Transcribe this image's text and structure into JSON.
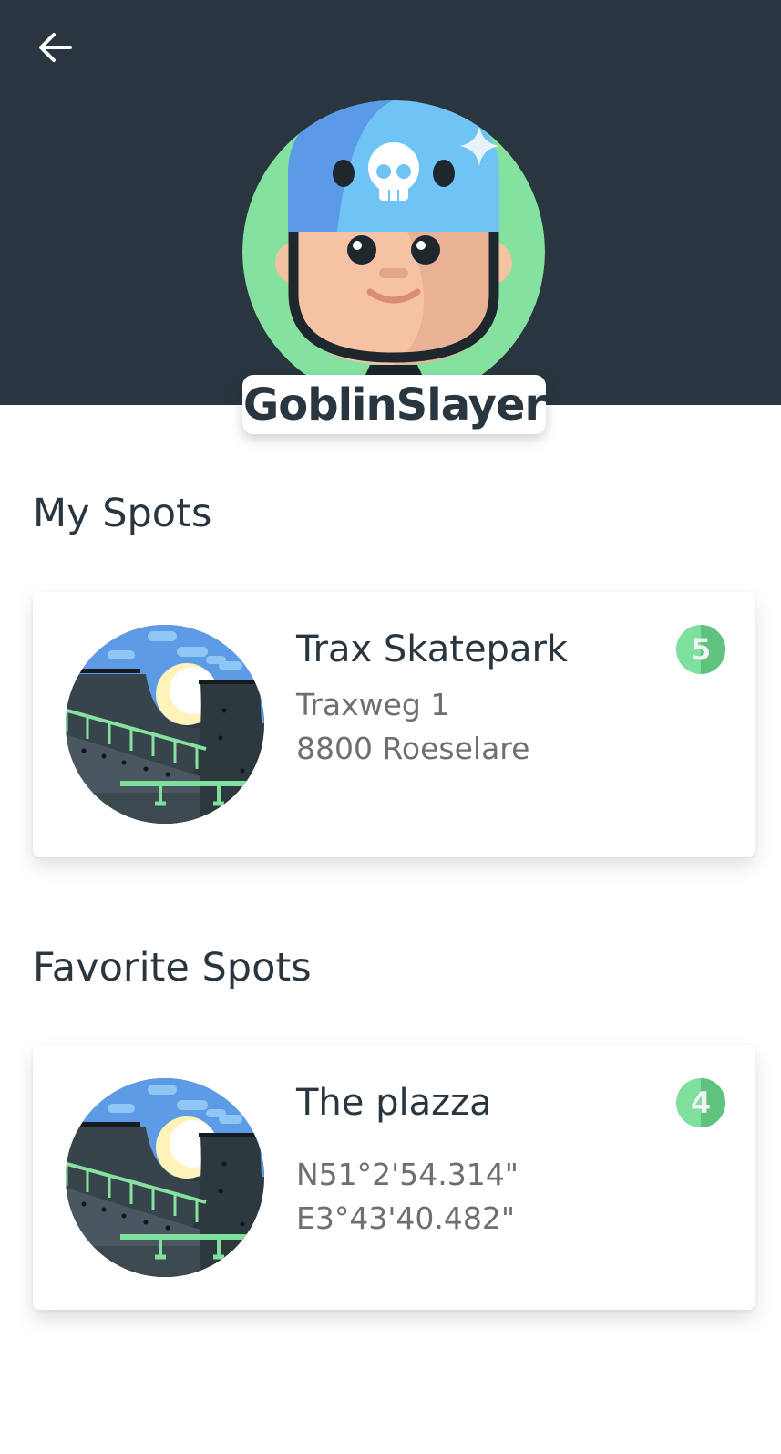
{
  "header": {
    "back_icon": "arrow-left-icon",
    "username": "GoblinSlayer",
    "avatar": "helmet-skater-avatar"
  },
  "my_spots": {
    "title": "My Spots",
    "items": [
      {
        "name": "Trax Skatepark",
        "line1": "Traxweg 1",
        "line2": "8800 Roeselare",
        "rating": "5",
        "image": "skatepark-ramp-image"
      }
    ]
  },
  "favorite_spots": {
    "title": "Favorite Spots",
    "items": [
      {
        "name": "The plazza",
        "line1": "N51°2'54.314\"",
        "line2": "E3°43'40.482\"",
        "rating": "4",
        "image": "skatepark-ramp-image"
      }
    ]
  },
  "colors": {
    "header_bg": "#2a363f",
    "accent_green": "#7fdf9c",
    "text_dark": "#2a363f",
    "text_muted": "#6f6f6f"
  }
}
